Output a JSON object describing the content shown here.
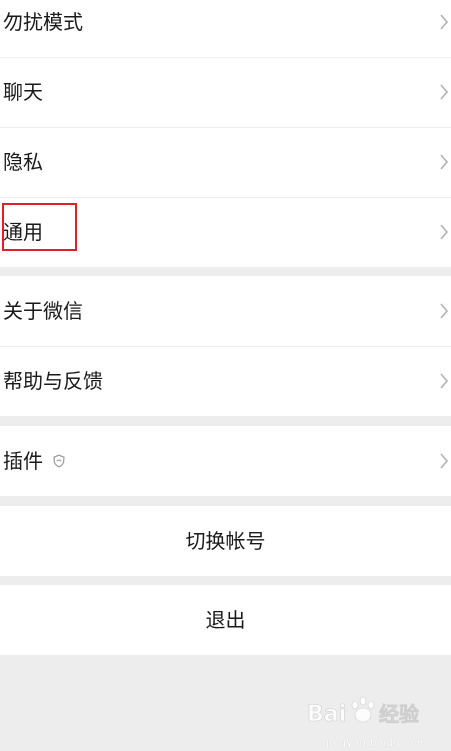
{
  "settings": {
    "group1": [
      {
        "label": "勿扰模式"
      },
      {
        "label": "聊天"
      },
      {
        "label": "隐私"
      },
      {
        "label": "通用"
      }
    ],
    "group2": [
      {
        "label": "关于微信"
      },
      {
        "label": "帮助与反馈"
      }
    ],
    "group3": [
      {
        "label": "插件"
      }
    ]
  },
  "actions": {
    "switch_account": "切换帐号",
    "logout": "退出"
  },
  "watermark": {
    "brand": "Bai",
    "site": "jingyan.baidu.com"
  },
  "colors": {
    "highlight": "#d8232a",
    "background": "#ededed"
  }
}
